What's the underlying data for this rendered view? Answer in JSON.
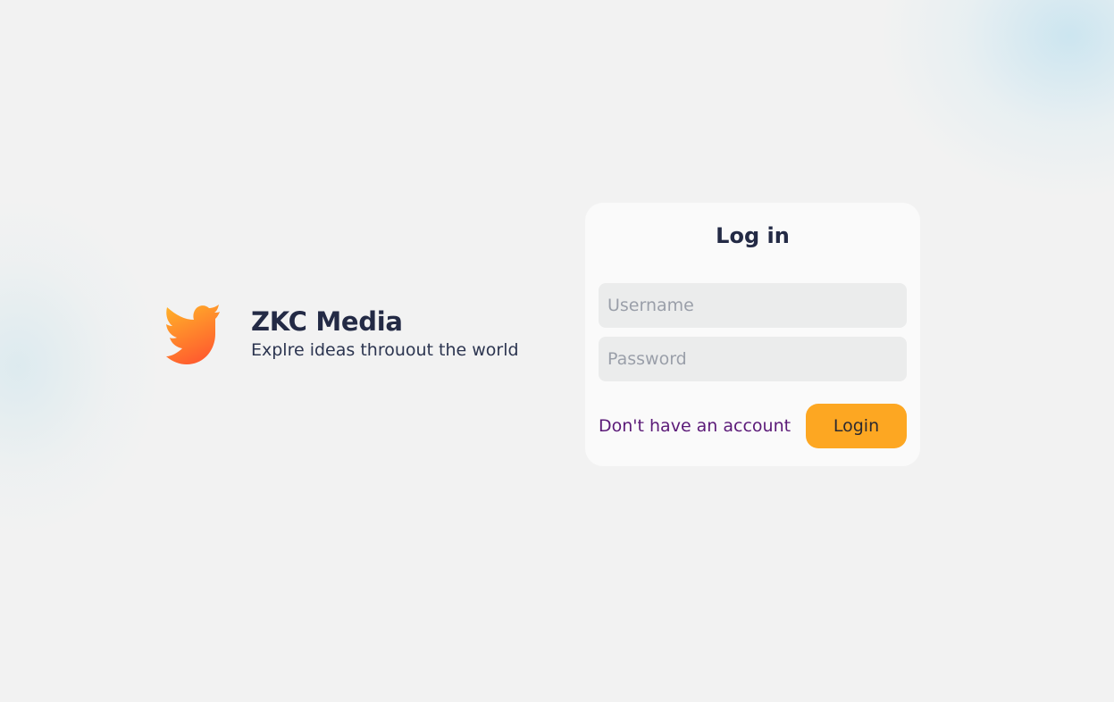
{
  "brand": {
    "name": "ZKC Media",
    "tagline": "Explre ideas throuout the world",
    "logo_icon": "bird-icon",
    "logo_gradient": [
      "#ffb429",
      "#ff6a2b"
    ]
  },
  "login_card": {
    "title": "Log in",
    "username_placeholder": "Username",
    "password_placeholder": "Password",
    "signup_link_label": "Don't have an account",
    "login_button_label": "Login"
  },
  "colors": {
    "background": "#f2f2f2",
    "card": "#fafafa",
    "input": "#ebecec",
    "accent": "#fda722",
    "link": "#5b1a78",
    "heading": "#232a45"
  }
}
